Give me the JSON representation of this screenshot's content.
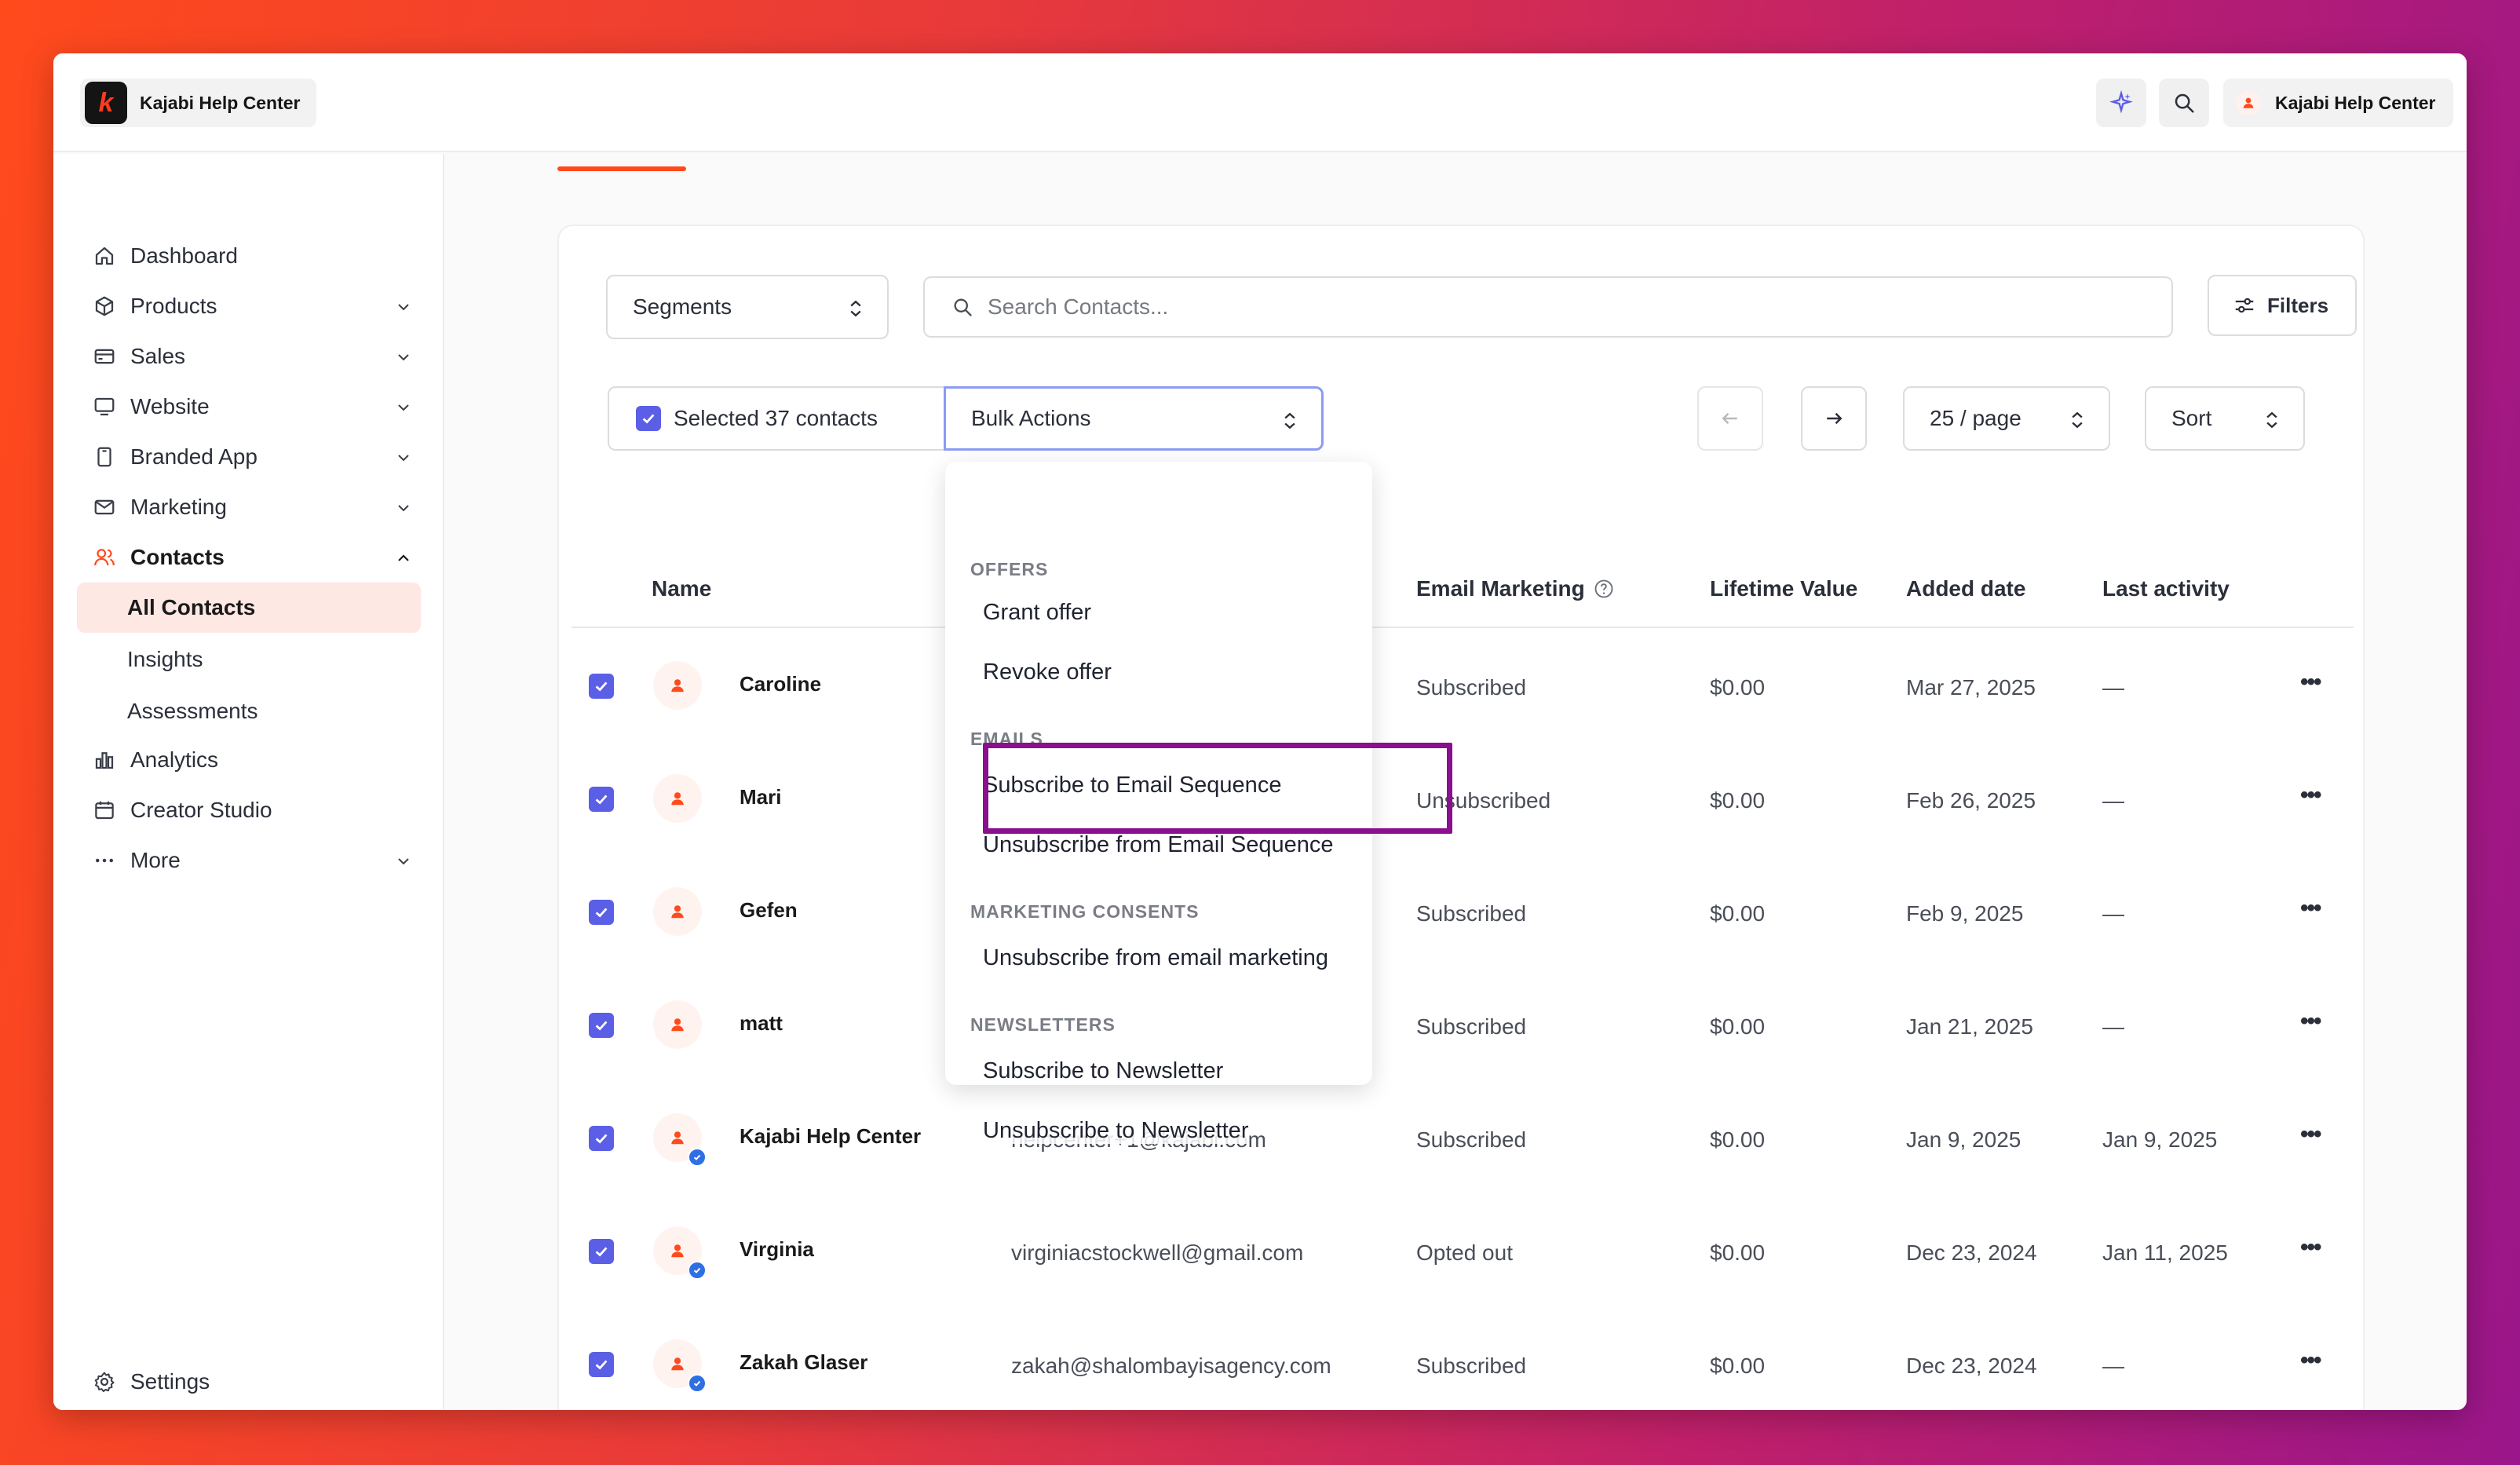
{
  "app": {
    "brand_name": "Kajabi Help Center",
    "user_name": "Kajabi Help Center",
    "accent_color": "#ff4a1c",
    "highlight_color": "#8b0f8e"
  },
  "sidebar": {
    "items": [
      {
        "label": "Dashboard",
        "icon": "home-icon"
      },
      {
        "label": "Products",
        "icon": "cube-icon"
      },
      {
        "label": "Sales",
        "icon": "card-icon"
      },
      {
        "label": "Website",
        "icon": "monitor-icon"
      },
      {
        "label": "Branded App",
        "icon": "phone-icon"
      },
      {
        "label": "Marketing",
        "icon": "mail-icon"
      },
      {
        "label": "Contacts",
        "icon": "users-icon"
      },
      {
        "label": "Analytics",
        "icon": "chart-icon"
      },
      {
        "label": "Creator Studio",
        "icon": "calendar-icon"
      },
      {
        "label": "More",
        "icon": "more-icon"
      }
    ],
    "contacts_sub": [
      "All Contacts",
      "Insights",
      "Assessments"
    ],
    "settings_label": "Settings"
  },
  "toolbar": {
    "segments_label": "Segments",
    "search_placeholder": "Search Contacts...",
    "filters_label": "Filters",
    "selected_label": "Selected 37 contacts",
    "bulk_actions_label": "Bulk Actions",
    "per_page_label": "25 / page",
    "sort_label": "Sort"
  },
  "table": {
    "headers": [
      "Name",
      "Email Marketing",
      "Lifetime Value",
      "Added date",
      "Last activity"
    ],
    "rows": [
      {
        "name": "Caroline",
        "email": "",
        "marketing": "Subscribed",
        "value": "$0.00",
        "added": "Mar 27, 2025",
        "last": "—"
      },
      {
        "name": "Mari",
        "email": "",
        "marketing": "Unsubscribed",
        "value": "$0.00",
        "added": "Feb 26, 2025",
        "last": "—"
      },
      {
        "name": "Gefen",
        "email": "",
        "marketing": "Subscribed",
        "value": "$0.00",
        "added": "Feb 9, 2025",
        "last": "—"
      },
      {
        "name": "matt",
        "email": "",
        "marketing": "Subscribed",
        "value": "$0.00",
        "added": "Jan 21, 2025",
        "last": "—"
      },
      {
        "name": "Kajabi Help Center",
        "email": "helpcenter+1@kajabi.com",
        "marketing": "Subscribed",
        "value": "$0.00",
        "added": "Jan 9, 2025",
        "last": "Jan 9, 2025"
      },
      {
        "name": "Virginia",
        "email": "virginiacstockwell@gmail.com",
        "marketing": "Opted out",
        "value": "$0.00",
        "added": "Dec 23, 2024",
        "last": "Jan 11, 2025"
      },
      {
        "name": "Zakah Glaser",
        "email": "zakah@shalombayisagency.com",
        "marketing": "Subscribed",
        "value": "$0.00",
        "added": "Dec 23, 2024",
        "last": "—"
      }
    ]
  },
  "bulk_menu": {
    "offers_heading": "OFFERS",
    "grant_offer": "Grant offer",
    "revoke_offer": "Revoke offer",
    "emails_heading": "EMAILS",
    "subscribe_sequence": "Subscribe to Email Sequence",
    "unsubscribe_sequence": "Unsubscribe from Email Sequence",
    "consents_heading": "MARKETING CONSENTS",
    "unsubscribe_marketing": "Unsubscribe from email marketing",
    "newsletters_heading": "NEWSLETTERS",
    "subscribe_newsletter": "Subscribe to Newsletter",
    "unsubscribe_newsletter": "Unsubscribe to Newsletter"
  }
}
